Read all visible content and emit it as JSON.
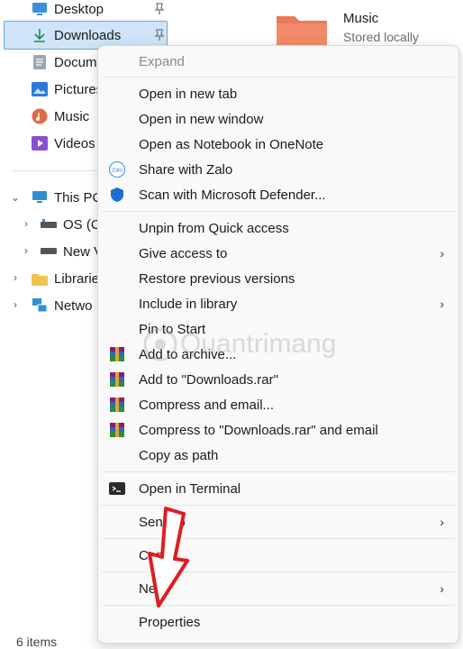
{
  "nav": {
    "items": [
      {
        "label": "Desktop"
      },
      {
        "label": "Downloads"
      },
      {
        "label": "Docume"
      },
      {
        "label": "Pictures"
      },
      {
        "label": "Music"
      },
      {
        "label": "Videos"
      }
    ],
    "this_pc": "This PC",
    "drives": [
      {
        "label": "OS (C:"
      },
      {
        "label": "New V"
      }
    ],
    "libraries": "Librarie",
    "network": "Netwo"
  },
  "content": {
    "music_title": "Music",
    "music_subtitle": "Stored locally"
  },
  "status_bar": {
    "items": "6 items"
  },
  "menu": {
    "expand": "Expand",
    "group1": [
      {
        "label": "Open in new tab"
      },
      {
        "label": "Open in new window"
      },
      {
        "label": "Open as Notebook in OneNote"
      },
      {
        "label": "Share with Zalo",
        "icon": "zalo-icon"
      },
      {
        "label": "Scan with Microsoft Defender...",
        "icon": "defender-shield-icon"
      }
    ],
    "group2": [
      {
        "label": "Unpin from Quick access"
      },
      {
        "label": "Give access to",
        "submenu": true
      },
      {
        "label": "Restore previous versions"
      },
      {
        "label": "Include in library",
        "submenu": true
      },
      {
        "label": "Pin to Start"
      },
      {
        "label": "Add to archive...",
        "icon": "winrar-icon"
      },
      {
        "label": "Add to \"Downloads.rar\"",
        "icon": "winrar-icon"
      },
      {
        "label": "Compress and email...",
        "icon": "winrar-icon"
      },
      {
        "label": "Compress to \"Downloads.rar\" and email",
        "icon": "winrar-icon"
      },
      {
        "label": "Copy as path"
      }
    ],
    "terminal": "Open in Terminal",
    "send_to": "Send to",
    "copy": "Copy",
    "new": "New",
    "properties": "Properties",
    "submenu_glyph": "›"
  },
  "watermark": "Quantrimang",
  "colors": {
    "selection": "#cfe4f7",
    "arrow": "#e11b22",
    "defender": "#1f6fd1",
    "folder": "#f2c14e"
  }
}
